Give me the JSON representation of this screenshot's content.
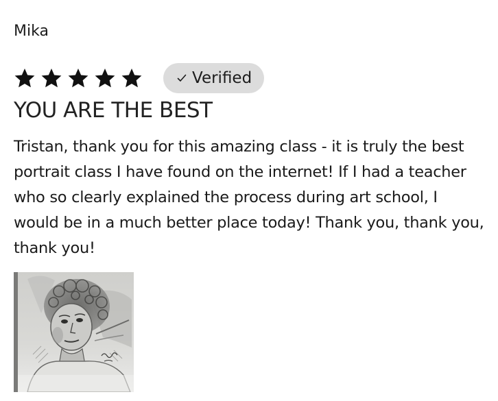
{
  "review": {
    "reviewer_name": "Mika",
    "rating": 5,
    "rating_max": 5,
    "verified_label": "Verified",
    "title": "YOU ARE THE BEST",
    "body": "Tristan, thank you for this amazing class - it is truly the best portrait class I have found on the internet! If I had a teacher who so clearly explained the process during art school, I would be in a much better place today! Thank you, thank you, thank you!",
    "photo": {
      "icon": "pencil-portrait-drawing"
    }
  },
  "colors": {
    "star": "#111111",
    "badge_bg": "#dcdcdc",
    "text": "#1a1a1a"
  }
}
